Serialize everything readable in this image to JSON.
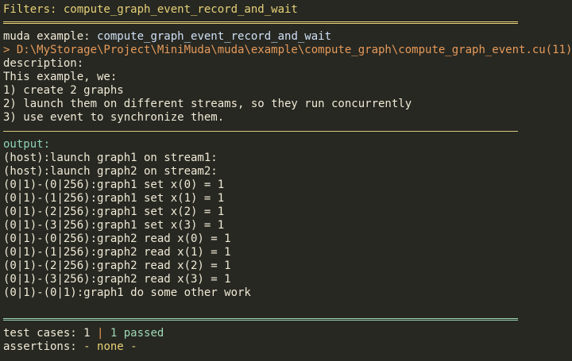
{
  "header": {
    "filters_label": "Filters: compute_graph_event_record_and_wait"
  },
  "example": {
    "prefix": "muda example: ",
    "name": "compute_graph_event_record_and_wait",
    "path": "> D:\\MyStorage\\Project\\MiniMuda\\muda\\example\\compute_graph\\compute_graph_event.cu(11)",
    "description_label": "description:",
    "description_lines": [
      "This example, we:",
      "1) create 2 graphs",
      "2) launch them on different streams, so they run concurrently",
      "3) use event to synchronize them."
    ]
  },
  "output": {
    "label": "output:",
    "lines": [
      "(host):launch graph1 on stream1:",
      "(host):launch graph2 on stream2:",
      "(0|1)-(0|256):graph1 set x(0) = 1",
      "(0|1)-(1|256):graph1 set x(1) = 1",
      "(0|1)-(2|256):graph1 set x(2) = 1",
      "(0|1)-(3|256):graph1 set x(3) = 1",
      "(0|1)-(0|256):graph2 read x(0) = 1",
      "(0|1)-(1|256):graph2 read x(1) = 1",
      "(0|1)-(2|256):graph2 read x(2) = 1",
      "(0|1)-(3|256):graph2 read x(3) = 1",
      "(0|1)-(0|1):graph1 do some other work"
    ]
  },
  "summary": {
    "test_cases_label": "test cases: ",
    "test_cases_count": "1",
    "separator": " | ",
    "passed": "1 passed",
    "assertions_label": "assertions: ",
    "assertions_value": "- none -"
  },
  "colors": {
    "background": "#272822",
    "text": "#f0ead6",
    "yellow": "#e6d178",
    "orange": "#e69a5a",
    "teal": "#8ed3b4",
    "green": "#9fd9b7"
  }
}
